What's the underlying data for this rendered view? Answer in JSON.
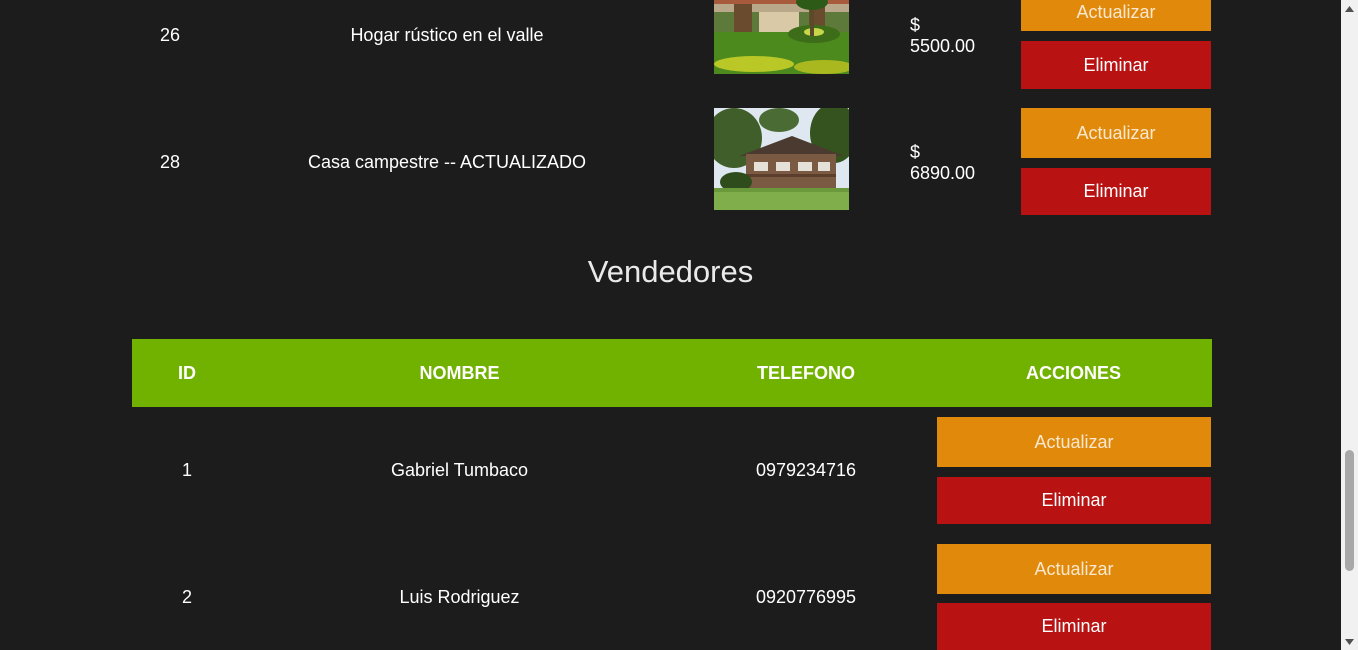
{
  "propiedades": {
    "rows": [
      {
        "id": "26",
        "titulo": "Hogar rústico en el valle",
        "precio": "$ 5500.00",
        "imagen": "rustic-house-garden-photo"
      },
      {
        "id": "28",
        "titulo": "Casa campestre -- ACTUALIZADO",
        "precio": "$ 6890.00",
        "imagen": "country-house-lawn-photo"
      }
    ]
  },
  "acciones": {
    "actualizar": "Actualizar",
    "eliminar": "Eliminar"
  },
  "vendedores": {
    "title": "Vendedores",
    "headers": {
      "id": "ID",
      "nombre": "NOMBRE",
      "telefono": "TELEFONO",
      "acciones": "ACCIONES"
    },
    "rows": [
      {
        "id": "1",
        "nombre": "Gabriel Tumbaco",
        "telefono": "0979234716"
      },
      {
        "id": "2",
        "nombre": "Luis Rodriguez",
        "telefono": "0920776995"
      }
    ]
  },
  "colors": {
    "background": "#1c1c1c",
    "header_green": "#71b100",
    "update_orange": "#e0890b",
    "delete_red": "#b81212"
  },
  "scroll": {
    "position_fraction": 0.75
  }
}
